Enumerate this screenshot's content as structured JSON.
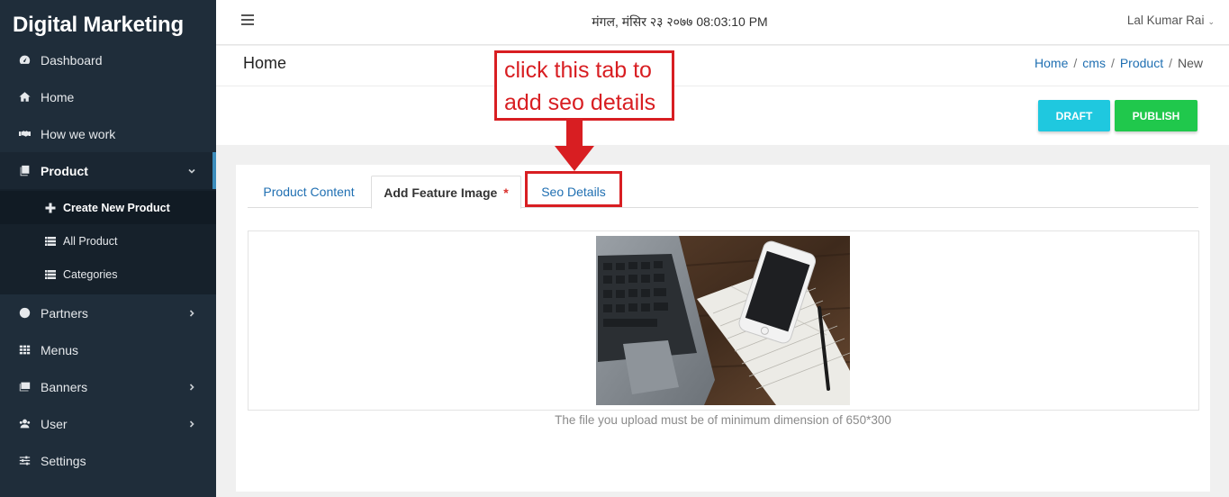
{
  "brand": "Digital Marketing",
  "sidebar": {
    "items": [
      {
        "label": "Dashboard",
        "icon": "dashboard-icon"
      },
      {
        "label": "Home",
        "icon": "home-icon"
      },
      {
        "label": "How we work",
        "icon": "handshake-icon"
      },
      {
        "label": "Product",
        "icon": "product-icon",
        "expanded": true
      },
      {
        "label": "Partners",
        "icon": "partners-icon"
      },
      {
        "label": "Menus",
        "icon": "grid-icon"
      },
      {
        "label": "Banners",
        "icon": "images-icon"
      },
      {
        "label": "User",
        "icon": "users-icon"
      },
      {
        "label": "Settings",
        "icon": "sliders-icon"
      }
    ],
    "product_sub": [
      {
        "label": "Create New Product",
        "icon": "plus-icon"
      },
      {
        "label": "All Product",
        "icon": "list-icon"
      },
      {
        "label": "Categories",
        "icon": "list-icon"
      }
    ]
  },
  "topbar": {
    "datetime": "मंगल, मंसिर २३ २०७७ 08:03:10 PM",
    "user": "Lal Kumar Rai"
  },
  "page": {
    "title": "Home",
    "breadcrumb": [
      "Home",
      "cms",
      "Product",
      "New"
    ]
  },
  "actions": {
    "draft": "DRAFT",
    "publish": "PUBLISH"
  },
  "tabs": [
    {
      "label": "Product Content"
    },
    {
      "label": "Add Feature Image",
      "required_mark": "*",
      "active": true
    },
    {
      "label": "Seo Details"
    }
  ],
  "feature_image": {
    "hint": "The file you upload must be of minimum dimension of 650*300"
  },
  "annotation": {
    "line1": "click this tab to",
    "line2": "add seo details"
  },
  "colors": {
    "sidebar_bg": "#1f2d3a",
    "accent_link": "#1f6fb2",
    "draft_btn": "#1fc8df",
    "publish_btn": "#20c84c",
    "annotation_red": "#d81e22"
  }
}
